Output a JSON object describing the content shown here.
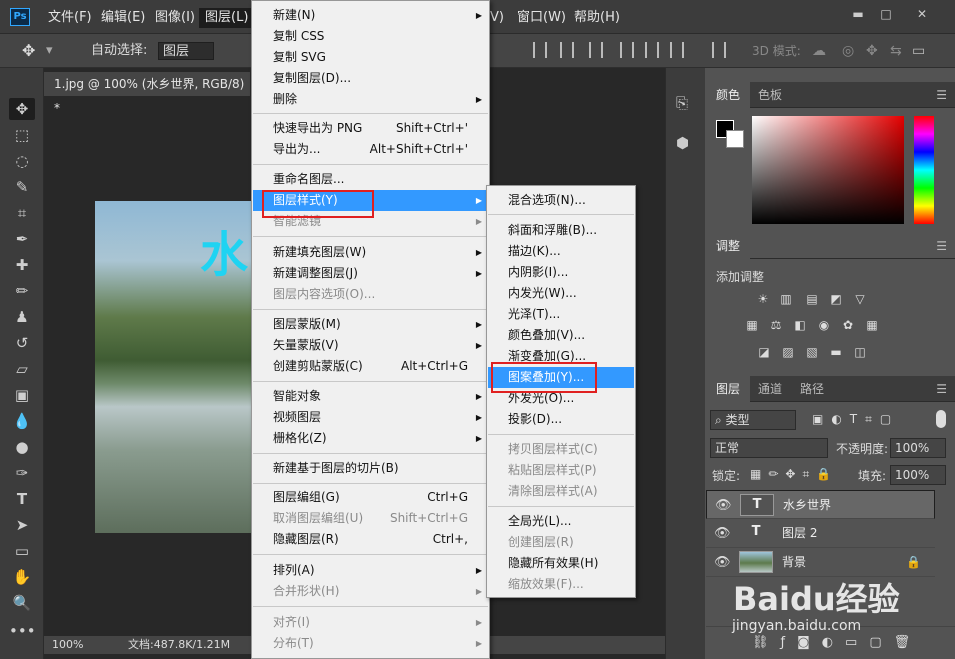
{
  "menubar": {
    "logo": "Ps",
    "items": [
      "文件(F)",
      "编辑(E)",
      "图像(I)",
      "图层(L)",
      "V)",
      "窗口(W)",
      "帮助(H)"
    ],
    "window_buttons": [
      "▬",
      "□",
      "✕"
    ]
  },
  "options": {
    "auto_select_label": "自动选择:",
    "auto_select_value": "图层",
    "mode_3d": "3D 模式:"
  },
  "document": {
    "tab_title": "1.jpg @ 100% (水乡世界, RGB/8) *",
    "tab_close": "×",
    "canvas_text": "水",
    "zoom": "100%",
    "doc_size": "文档:487.8K/1.21M"
  },
  "color_panel": {
    "tabs": [
      "颜色",
      "色板"
    ]
  },
  "adjust_panel": {
    "title": "调整",
    "subtitle": "添加调整"
  },
  "layers_panel": {
    "tabs": [
      "图层",
      "通道",
      "路径"
    ],
    "filter_label": "类型",
    "blend_mode": "正常",
    "opacity_label": "不透明度:",
    "opacity_value": "100%",
    "lock_label": "锁定:",
    "fill_label": "填充:",
    "fill_value": "100%",
    "layers": [
      {
        "name": "水乡世界",
        "thumb": "T"
      },
      {
        "name": "图层 2",
        "thumb": "T"
      },
      {
        "name": "背景",
        "thumb": ""
      }
    ]
  },
  "main_menu": [
    {
      "label": "新建(N)",
      "arrow": true
    },
    {
      "label": "复制 CSS"
    },
    {
      "label": "复制 SVG"
    },
    {
      "label": "复制图层(D)..."
    },
    {
      "label": "删除",
      "arrow": true
    },
    {
      "label": "快速导出为 PNG",
      "shortcut": "Shift+Ctrl+'"
    },
    {
      "label": "导出为...",
      "shortcut": "Alt+Shift+Ctrl+'"
    },
    {
      "label": "重命名图层..."
    },
    {
      "label": "图层样式(Y)",
      "arrow": true
    },
    {
      "label": "智能滤镜",
      "arrow": true
    },
    {
      "label": "新建填充图层(W)",
      "arrow": true
    },
    {
      "label": "新建调整图层(J)",
      "arrow": true
    },
    {
      "label": "图层内容选项(O)..."
    },
    {
      "label": "图层蒙版(M)",
      "arrow": true
    },
    {
      "label": "矢量蒙版(V)",
      "arrow": true
    },
    {
      "label": "创建剪贴蒙版(C)",
      "shortcut": "Alt+Ctrl+G"
    },
    {
      "label": "智能对象",
      "arrow": true
    },
    {
      "label": "视频图层",
      "arrow": true
    },
    {
      "label": "栅格化(Z)",
      "arrow": true
    },
    {
      "label": "新建基于图层的切片(B)"
    },
    {
      "label": "图层编组(G)",
      "shortcut": "Ctrl+G"
    },
    {
      "label": "取消图层编组(U)",
      "shortcut": "Shift+Ctrl+G"
    },
    {
      "label": "隐藏图层(R)",
      "shortcut": "Ctrl+,"
    },
    {
      "label": "排列(A)",
      "arrow": true
    },
    {
      "label": "合并形状(H)",
      "arrow": true
    },
    {
      "label": "对齐(I)",
      "arrow": true
    },
    {
      "label": "分布(T)",
      "arrow": true
    }
  ],
  "sub_menu": [
    {
      "label": "混合选项(N)..."
    },
    {
      "label": "斜面和浮雕(B)..."
    },
    {
      "label": "描边(K)..."
    },
    {
      "label": "内阴影(I)..."
    },
    {
      "label": "内发光(W)..."
    },
    {
      "label": "光泽(T)..."
    },
    {
      "label": "颜色叠加(V)..."
    },
    {
      "label": "渐变叠加(G)..."
    },
    {
      "label": "图案叠加(Y)..."
    },
    {
      "label": "外发光(O)..."
    },
    {
      "label": "投影(D)..."
    },
    {
      "label": "拷贝图层样式(C)"
    },
    {
      "label": "粘贴图层样式(P)"
    },
    {
      "label": "清除图层样式(A)"
    },
    {
      "label": "全局光(L)..."
    },
    {
      "label": "创建图层(R)"
    },
    {
      "label": "隐藏所有效果(H)"
    },
    {
      "label": "缩放效果(F)..."
    }
  ],
  "watermark": {
    "brand": "Baidu经验",
    "url": "jingyan.baidu.com"
  },
  "colors": {
    "highlight": "#3399ff",
    "annotation": "#e02020",
    "canvas_text": "#1fd3f2"
  }
}
